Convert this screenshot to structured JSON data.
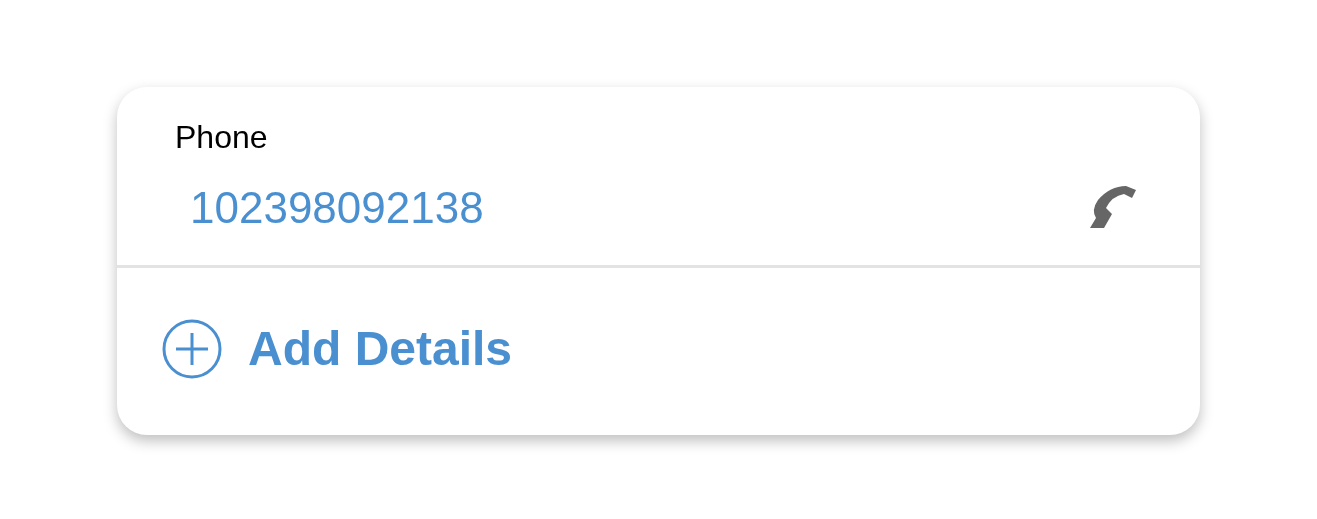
{
  "phone": {
    "label": "Phone",
    "number": "102398092138"
  },
  "add_button": {
    "label": "Add Details"
  }
}
